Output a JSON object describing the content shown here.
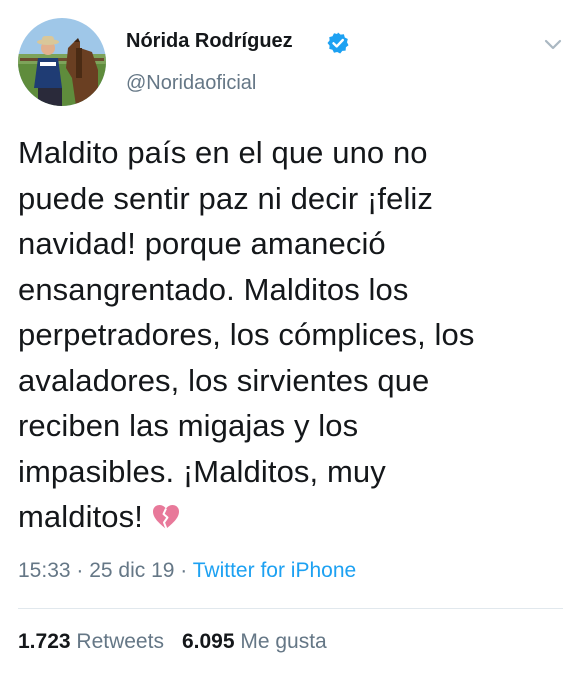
{
  "author": {
    "display_name": "Nórida Rodríguez",
    "handle": "@Noridaoficial",
    "verified": true,
    "avatar_icon": "profile-photo-woman-with-horse"
  },
  "tweet": {
    "lines": [
      "Maldito país en el que uno no",
      "puede sentir paz ni decir ¡feliz",
      "navidad! porque amaneció",
      "ensangrentado. Malditos los",
      "perpetradores, los cómplices, los",
      "avaladores, los sirvientes que",
      "reciben las migajas y los",
      "impasibles. ¡Malditos, muy",
      "malditos!"
    ],
    "emoji": "broken-heart-icon"
  },
  "meta": {
    "time": "15:33",
    "separator": " · ",
    "date": "25 dic 19",
    "source": "Twitter for iPhone"
  },
  "stats": {
    "retweets_count": "1.723",
    "retweets_label": "Retweets",
    "likes_count": "6.095",
    "likes_label": "Me gusta"
  },
  "colors": {
    "text": "#14171a",
    "secondary": "#657786",
    "accent": "#1da1f2",
    "divider": "#e1e8ed",
    "broken_heart": "#e8799a"
  }
}
